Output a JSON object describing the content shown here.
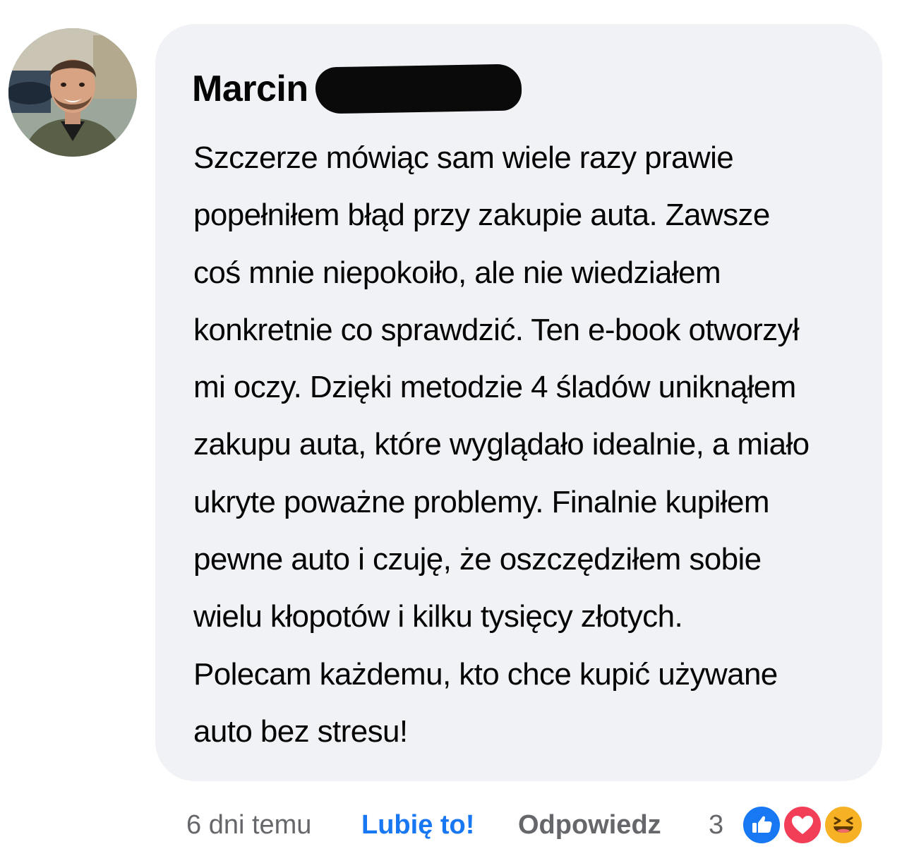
{
  "comment": {
    "author": {
      "first_name": "Marcin",
      "avatar_icon": "person-avatar-photo"
    },
    "text": "Szczerze mówiąc sam wiele razy prawie\npopełniłem błąd przy zakupie auta. Zawsze\ncoś mnie niepokoiło, ale nie wiedziałem\nkonkretnie co sprawdzić. Ten e-book otworzył\nmi oczy. Dzięki metodzie 4 śladów uniknąłem\nzakupu auta, które wyglądało idealnie, a miało\nukryte poważne problemy. Finalnie kupiłem\npewne auto i czuję, że oszczędziłem sobie\nwielu kłopotów i kilku tysięcy złotych.\nPolecam każdemu, kto chce kupić używane\nauto bez stresu!"
  },
  "actions": {
    "time": "6 dni temu",
    "like_label": "Lubię to!",
    "reply_label": "Odpowiedz"
  },
  "reactions": {
    "count": "3",
    "icons": [
      "thumbs-up-icon",
      "heart-icon",
      "laughing-face-icon"
    ]
  },
  "colors": {
    "bubble_bg": "#f0f2f5",
    "like_blue": "#1877f2",
    "meta_gray": "#65676b",
    "love_red": "#f33e58",
    "haha_yellow": "#f7b125"
  }
}
